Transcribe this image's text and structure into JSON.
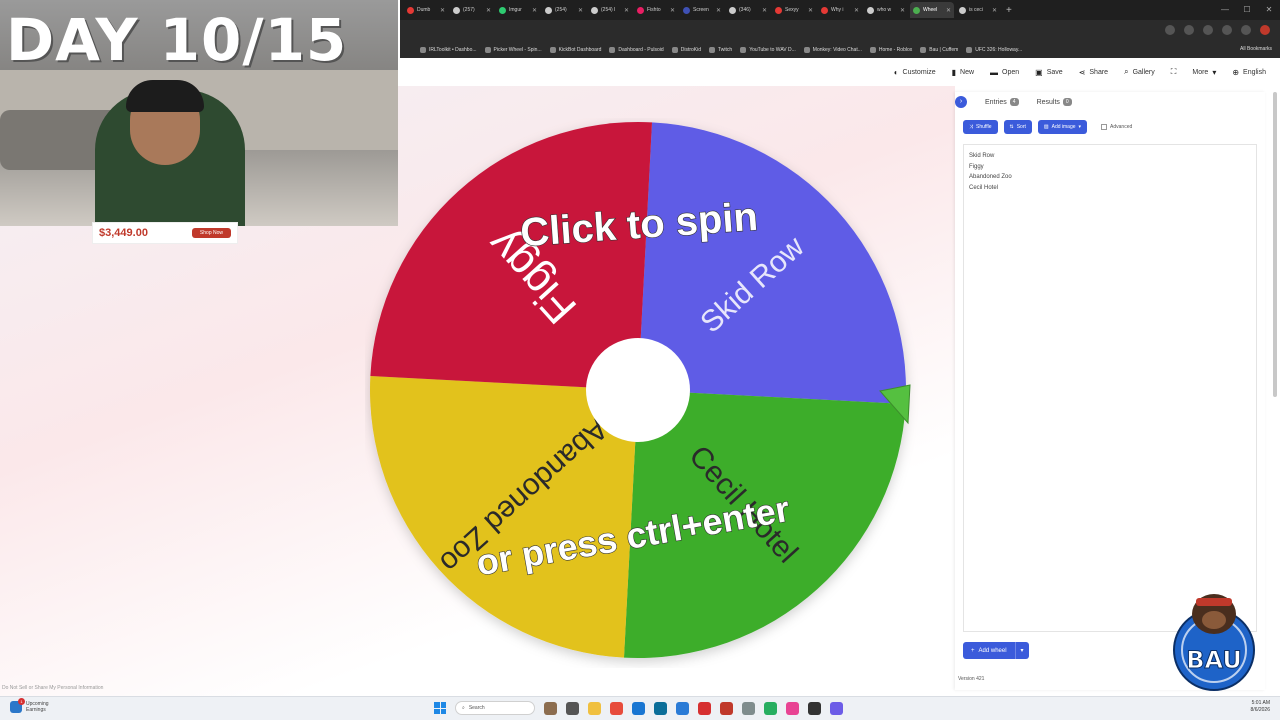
{
  "overlay": {
    "day_text": "DAY 10/15",
    "ad_price": "$3,449.00",
    "ad_button": "Shop Now",
    "do_not_sell": "Do Not Sell or Share My Personal Information"
  },
  "browser": {
    "tabs": [
      {
        "label": "Dumb",
        "color": "#e53935"
      },
      {
        "label": "(257)",
        "color": "#cccccc"
      },
      {
        "label": "Imgur",
        "color": "#2ecc71"
      },
      {
        "label": "(254)",
        "color": "#cccccc"
      },
      {
        "label": "(254) I",
        "color": "#cccccc"
      },
      {
        "label": "Fishto",
        "color": "#e91e63"
      },
      {
        "label": "Screen",
        "color": "#3f51b5"
      },
      {
        "label": "(346)",
        "color": "#cccccc"
      },
      {
        "label": "Sexyy",
        "color": "#e53935"
      },
      {
        "label": "Why i",
        "color": "#e53935"
      },
      {
        "label": "who w",
        "color": "#cccccc"
      },
      {
        "label": "Wheel",
        "color": "#4caf50",
        "active": true
      },
      {
        "label": "is ceci",
        "color": "#cccccc"
      }
    ],
    "bookmarks": [
      "IRLToolkit • Dashbo...",
      "Picker Wheel - Spin...",
      "KickBot Dashboard",
      "Dashboard - Pulsoid",
      "DistroKid",
      "Twitch",
      "YouTube to WAV D...",
      "Monkey: Video Chat...",
      "Home - Roblox",
      "Bau | Cuffem",
      "UFC 326: Holloway..."
    ],
    "all_bookmarks": "All Bookmarks"
  },
  "toolbar": {
    "customize": "Customize",
    "new": "New",
    "open": "Open",
    "save": "Save",
    "share": "Share",
    "gallery": "Gallery",
    "more": "More",
    "language": "English"
  },
  "wheel": {
    "segments": [
      {
        "label": "Skid Row",
        "color": "#5e5ce6"
      },
      {
        "label": "Cecil Hotel",
        "color": "#3cad2c"
      },
      {
        "label": "Abandoned Zoo",
        "color": "#e2c21a"
      },
      {
        "label": "Figgy",
        "color": "#c8193b"
      }
    ],
    "prompt_top": "Click to spin",
    "prompt_bottom": "or press ctrl+enter"
  },
  "panel": {
    "entries_tab": "Entries",
    "entries_count": "4",
    "results_tab": "Results",
    "results_count": "0",
    "shuffle": "Shuffle",
    "sort": "Sort",
    "add_image": "Add image",
    "advanced": "Advanced",
    "entries": [
      "Skid Row",
      "Figgy",
      "Abandoned Zoo",
      "Cecil Hotel"
    ],
    "add_wheel": "Add wheel",
    "version": "Version 421"
  },
  "taskbar": {
    "weather_title": "Upcoming",
    "weather_sub": "Earnings",
    "weather_badge": "1",
    "search": "Search",
    "time": "5:01 AM",
    "date": "8/6/2026"
  }
}
